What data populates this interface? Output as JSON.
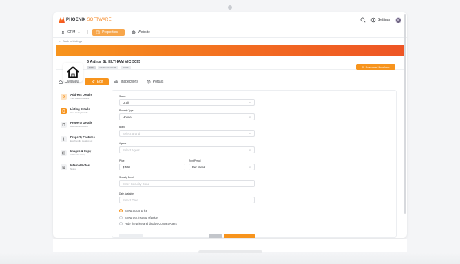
{
  "app": {
    "brand_primary": "PHOENIX",
    "brand_secondary": "SOFTWARE",
    "accent_color": "#f7941d",
    "settings_label": "Settings",
    "icons": {
      "search": "search-icon",
      "settings": "gear-icon",
      "avatar": "avatar"
    }
  },
  "nav": {
    "items": [
      {
        "label": "CRM",
        "icon": "crm-icon",
        "has_dropdown": true
      },
      {
        "label": "Properties",
        "icon": "properties-icon",
        "active": true
      },
      {
        "label": "Website",
        "icon": "globe-icon"
      }
    ]
  },
  "back_link": "Back to Listings",
  "property": {
    "address": "6 Arthur St, ELTHAM VIC 3095",
    "badges": [
      "Draft",
      "Residential Rental",
      "House"
    ],
    "download_label": "Download Brochure"
  },
  "tabs": [
    {
      "label": "Overview",
      "icon": "home-icon"
    },
    {
      "label": "Edit",
      "icon": "pencil-icon",
      "active": true
    },
    {
      "label": "Inspections",
      "icon": "eye-icon"
    },
    {
      "label": "Portals",
      "icon": "portal-icon"
    }
  ],
  "steps": [
    {
      "title": "Address Details",
      "subtitle": "Your Address details",
      "state": "done"
    },
    {
      "title": "Listing Details",
      "subtitle": "Your Listing Details",
      "state": "active"
    },
    {
      "title": "Property Details",
      "subtitle": "Bedrooms/Floor etc",
      "state": ""
    },
    {
      "title": "Property Features",
      "subtitle": "Eco friendly, Heating etc",
      "state": ""
    },
    {
      "title": "Images & Copy",
      "subtitle": "Add to the listing",
      "state": ""
    },
    {
      "title": "Internal Notes",
      "subtitle": "Notes",
      "state": ""
    }
  ],
  "form": {
    "status": {
      "label": "Status",
      "value": "Draft"
    },
    "property_type": {
      "label": "Property Type",
      "value": "House"
    },
    "brand": {
      "label": "Brand",
      "placeholder": "Select Brand"
    },
    "agents": {
      "label": "Agents",
      "placeholder": "Select Agent"
    },
    "price": {
      "label": "Price",
      "value": "$ 530"
    },
    "rent_period": {
      "label": "Rent Period",
      "value": "Per Week"
    },
    "security_bond": {
      "label": "Security Bond",
      "placeholder": "Enter Security Bond"
    },
    "date_available": {
      "label": "Date Available",
      "placeholder": "Select Date"
    },
    "price_display_options": [
      {
        "label": "Show actual price",
        "checked": true
      },
      {
        "label": "Show text instead of price",
        "checked": false
      },
      {
        "label": "Hide the price and display Contact Agent",
        "checked": false
      }
    ]
  }
}
